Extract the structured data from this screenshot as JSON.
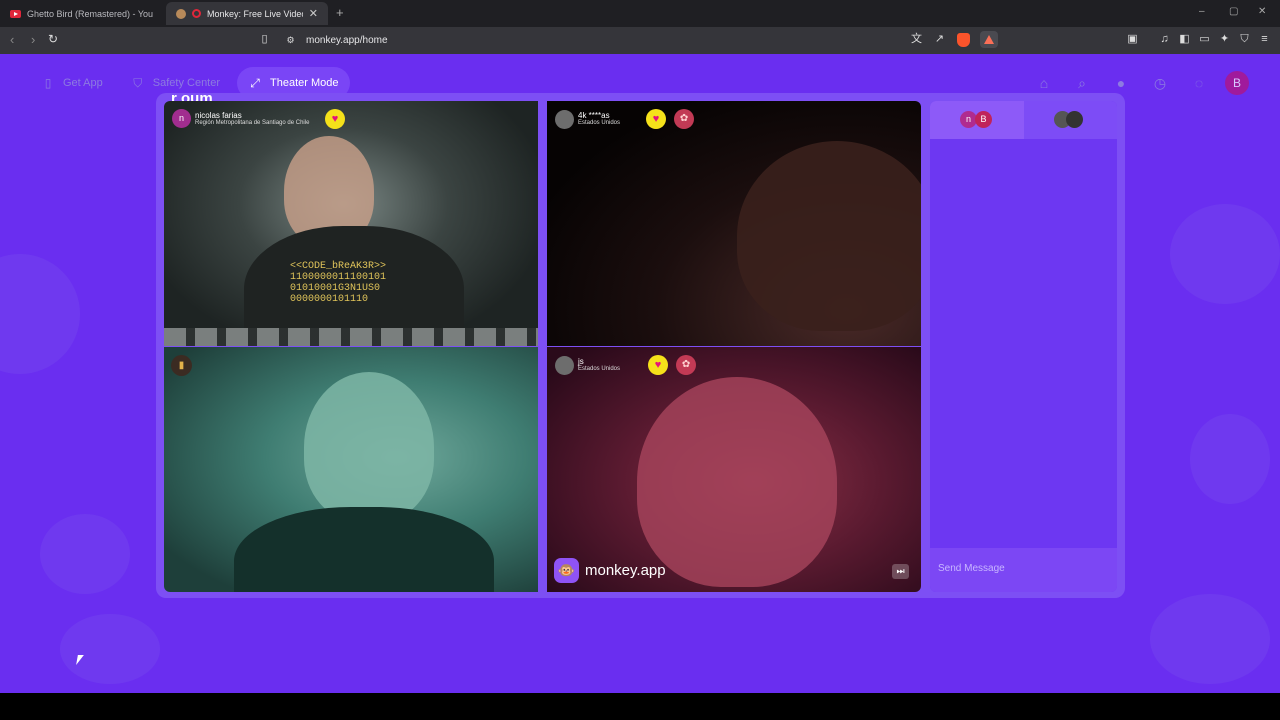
{
  "browser": {
    "tabs": [
      {
        "title": "Ghetto Bird (Remastered) - YouTube",
        "active": false
      },
      {
        "title": "Monkey: Free Live Video Chat",
        "active": true
      }
    ],
    "new_tab": "+",
    "url": "monkey.app/home",
    "window_controls": {
      "minimize": "–",
      "maximize": "▢",
      "close": "✕"
    }
  },
  "site": {
    "nav": {
      "get_app": "Get App",
      "safety_center": "Safety Center",
      "theater_mode": "Theater Mode"
    },
    "profile_initial": "B",
    "partial_heading": "r oum",
    "colors": {
      "background": "#6a2ef0",
      "accent": "#7a45f6",
      "heart": "#f5e11a"
    }
  },
  "tiles": {
    "a": {
      "avatar_initial": "n",
      "name": "nicolas farias",
      "location": "Región Metropolitana de Santiago de Chile",
      "shirt_lines": [
        "<<CODE_bReAK3R>>",
        "1100000011100101",
        "01010001G3N1US0",
        "0000000101110"
      ]
    },
    "b": {
      "name": "4k ****as",
      "location": "Estados Unidos"
    },
    "d": {
      "name": "js",
      "location": "Estados Unidos"
    }
  },
  "watermark": "monkey.app",
  "chat": {
    "tab1_initials": [
      "n",
      "B"
    ],
    "placeholder": "Send Message"
  }
}
